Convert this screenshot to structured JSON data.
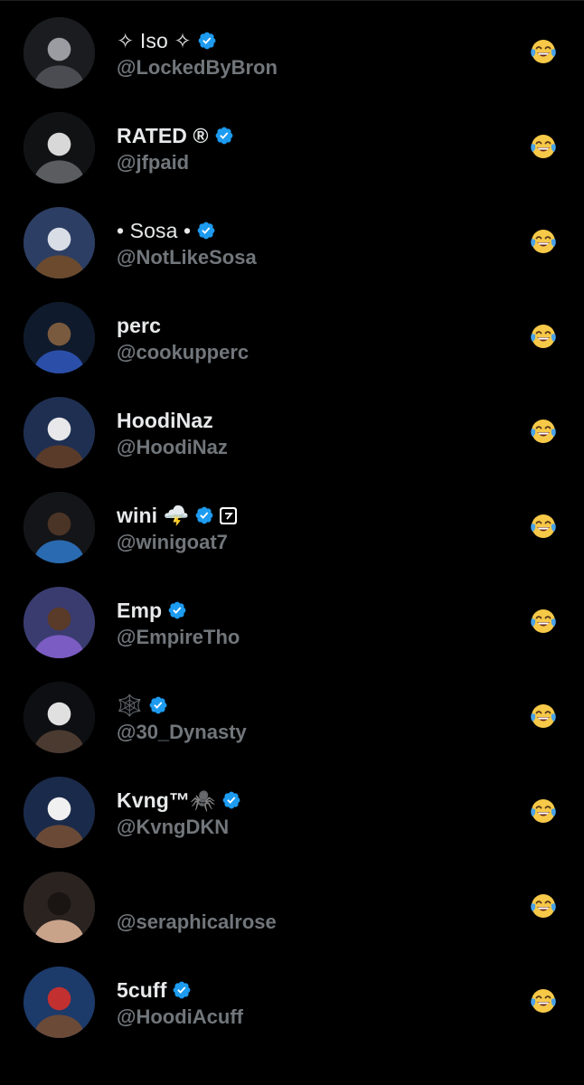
{
  "theme": {
    "background": "#000000",
    "name_color": "#e7e9ea",
    "handle_color": "#71767b",
    "verified_color": "#1d9bf0"
  },
  "reaction_emoji": "face-with-tears-of-joy",
  "users": [
    {
      "display_name": "✧ Iso ✧",
      "handle": "@LockedByBron",
      "verified": true,
      "extra": "",
      "avatar": "monochrome-basketball-photo"
    },
    {
      "display_name": "RATED ®",
      "handle": "@jfpaid",
      "verified": true,
      "extra": "",
      "avatar": "jersey-30-photo"
    },
    {
      "display_name": "• Sosa •",
      "handle": "@NotLikeSosa",
      "verified": true,
      "extra": "",
      "avatar": "football-player-photo"
    },
    {
      "display_name": "perc",
      "handle": "@cookupperc",
      "verified": false,
      "extra": "",
      "avatar": "basketball-celebration-photo"
    },
    {
      "display_name": "HoodiNaz",
      "handle": "@HoodiNaz",
      "verified": false,
      "extra": "",
      "avatar": "press-conference-photo"
    },
    {
      "display_name": "wini 🌩️",
      "handle": "@winigoat7",
      "verified": true,
      "extra": "affiliate-badge",
      "avatar": "blue-cap-photo"
    },
    {
      "display_name": "Emp",
      "handle": "@EmpireTho",
      "verified": true,
      "extra": "",
      "avatar": "purple-hoodie-photo"
    },
    {
      "display_name": "🕸️",
      "handle": "@30_Dynasty",
      "verified": true,
      "extra": "",
      "avatar": "hooded-player-photo"
    },
    {
      "display_name": "Kvng™🕷️",
      "handle": "@KvngDKN",
      "verified": true,
      "extra": "",
      "avatar": "finals-press-photo"
    },
    {
      "display_name": "",
      "handle": "@seraphicalrose",
      "verified": false,
      "extra": "",
      "avatar": "portrait-photo"
    },
    {
      "display_name": "5cuff",
      "handle": "@HoodiAcuff",
      "verified": true,
      "extra": "",
      "avatar": "march-madness-photo"
    }
  ]
}
